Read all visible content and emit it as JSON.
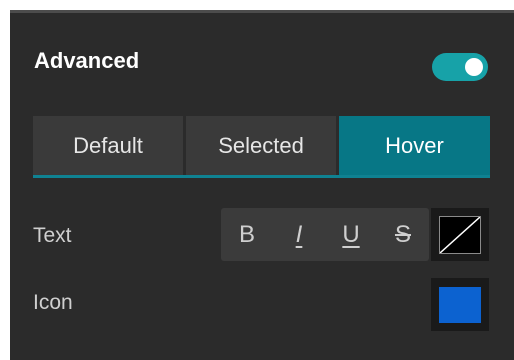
{
  "header": {
    "title": "Advanced",
    "toggle_on": true,
    "accent_color": "#17a2a8"
  },
  "tabs": [
    {
      "label": "Default",
      "active": false
    },
    {
      "label": "Selected",
      "active": false
    },
    {
      "label": "Hover",
      "active": true
    }
  ],
  "text_row": {
    "label": "Text",
    "format_buttons": [
      {
        "label": "B",
        "icon": "bold-icon"
      },
      {
        "label": "I",
        "icon": "italic-icon"
      },
      {
        "label": "U",
        "icon": "underline-icon"
      },
      {
        "label": "S",
        "icon": "strikethrough-icon"
      }
    ],
    "color": "none"
  },
  "icon_row": {
    "label": "Icon",
    "color": "#0c62d0"
  }
}
